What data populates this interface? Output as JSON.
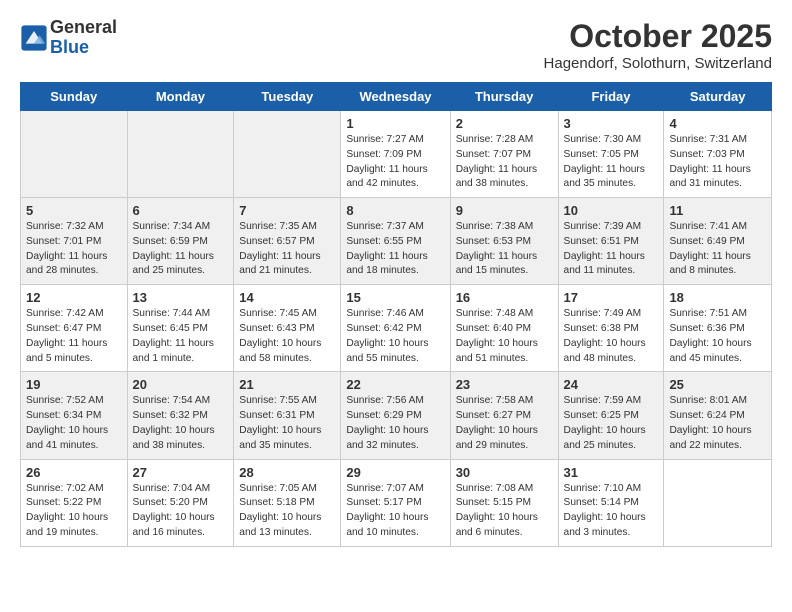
{
  "header": {
    "logo_general": "General",
    "logo_blue": "Blue",
    "month_title": "October 2025",
    "location": "Hagendorf, Solothurn, Switzerland"
  },
  "days_of_week": [
    "Sunday",
    "Monday",
    "Tuesday",
    "Wednesday",
    "Thursday",
    "Friday",
    "Saturday"
  ],
  "weeks": [
    {
      "days": [
        {
          "date": "",
          "info": ""
        },
        {
          "date": "",
          "info": ""
        },
        {
          "date": "",
          "info": ""
        },
        {
          "date": "1",
          "sunrise": "Sunrise: 7:27 AM",
          "sunset": "Sunset: 7:09 PM",
          "daylight": "Daylight: 11 hours and 42 minutes."
        },
        {
          "date": "2",
          "sunrise": "Sunrise: 7:28 AM",
          "sunset": "Sunset: 7:07 PM",
          "daylight": "Daylight: 11 hours and 38 minutes."
        },
        {
          "date": "3",
          "sunrise": "Sunrise: 7:30 AM",
          "sunset": "Sunset: 7:05 PM",
          "daylight": "Daylight: 11 hours and 35 minutes."
        },
        {
          "date": "4",
          "sunrise": "Sunrise: 7:31 AM",
          "sunset": "Sunset: 7:03 PM",
          "daylight": "Daylight: 11 hours and 31 minutes."
        }
      ]
    },
    {
      "days": [
        {
          "date": "5",
          "sunrise": "Sunrise: 7:32 AM",
          "sunset": "Sunset: 7:01 PM",
          "daylight": "Daylight: 11 hours and 28 minutes."
        },
        {
          "date": "6",
          "sunrise": "Sunrise: 7:34 AM",
          "sunset": "Sunset: 6:59 PM",
          "daylight": "Daylight: 11 hours and 25 minutes."
        },
        {
          "date": "7",
          "sunrise": "Sunrise: 7:35 AM",
          "sunset": "Sunset: 6:57 PM",
          "daylight": "Daylight: 11 hours and 21 minutes."
        },
        {
          "date": "8",
          "sunrise": "Sunrise: 7:37 AM",
          "sunset": "Sunset: 6:55 PM",
          "daylight": "Daylight: 11 hours and 18 minutes."
        },
        {
          "date": "9",
          "sunrise": "Sunrise: 7:38 AM",
          "sunset": "Sunset: 6:53 PM",
          "daylight": "Daylight: 11 hours and 15 minutes."
        },
        {
          "date": "10",
          "sunrise": "Sunrise: 7:39 AM",
          "sunset": "Sunset: 6:51 PM",
          "daylight": "Daylight: 11 hours and 11 minutes."
        },
        {
          "date": "11",
          "sunrise": "Sunrise: 7:41 AM",
          "sunset": "Sunset: 6:49 PM",
          "daylight": "Daylight: 11 hours and 8 minutes."
        }
      ]
    },
    {
      "days": [
        {
          "date": "12",
          "sunrise": "Sunrise: 7:42 AM",
          "sunset": "Sunset: 6:47 PM",
          "daylight": "Daylight: 11 hours and 5 minutes."
        },
        {
          "date": "13",
          "sunrise": "Sunrise: 7:44 AM",
          "sunset": "Sunset: 6:45 PM",
          "daylight": "Daylight: 11 hours and 1 minute."
        },
        {
          "date": "14",
          "sunrise": "Sunrise: 7:45 AM",
          "sunset": "Sunset: 6:43 PM",
          "daylight": "Daylight: 10 hours and 58 minutes."
        },
        {
          "date": "15",
          "sunrise": "Sunrise: 7:46 AM",
          "sunset": "Sunset: 6:42 PM",
          "daylight": "Daylight: 10 hours and 55 minutes."
        },
        {
          "date": "16",
          "sunrise": "Sunrise: 7:48 AM",
          "sunset": "Sunset: 6:40 PM",
          "daylight": "Daylight: 10 hours and 51 minutes."
        },
        {
          "date": "17",
          "sunrise": "Sunrise: 7:49 AM",
          "sunset": "Sunset: 6:38 PM",
          "daylight": "Daylight: 10 hours and 48 minutes."
        },
        {
          "date": "18",
          "sunrise": "Sunrise: 7:51 AM",
          "sunset": "Sunset: 6:36 PM",
          "daylight": "Daylight: 10 hours and 45 minutes."
        }
      ]
    },
    {
      "days": [
        {
          "date": "19",
          "sunrise": "Sunrise: 7:52 AM",
          "sunset": "Sunset: 6:34 PM",
          "daylight": "Daylight: 10 hours and 41 minutes."
        },
        {
          "date": "20",
          "sunrise": "Sunrise: 7:54 AM",
          "sunset": "Sunset: 6:32 PM",
          "daylight": "Daylight: 10 hours and 38 minutes."
        },
        {
          "date": "21",
          "sunrise": "Sunrise: 7:55 AM",
          "sunset": "Sunset: 6:31 PM",
          "daylight": "Daylight: 10 hours and 35 minutes."
        },
        {
          "date": "22",
          "sunrise": "Sunrise: 7:56 AM",
          "sunset": "Sunset: 6:29 PM",
          "daylight": "Daylight: 10 hours and 32 minutes."
        },
        {
          "date": "23",
          "sunrise": "Sunrise: 7:58 AM",
          "sunset": "Sunset: 6:27 PM",
          "daylight": "Daylight: 10 hours and 29 minutes."
        },
        {
          "date": "24",
          "sunrise": "Sunrise: 7:59 AM",
          "sunset": "Sunset: 6:25 PM",
          "daylight": "Daylight: 10 hours and 25 minutes."
        },
        {
          "date": "25",
          "sunrise": "Sunrise: 8:01 AM",
          "sunset": "Sunset: 6:24 PM",
          "daylight": "Daylight: 10 hours and 22 minutes."
        }
      ]
    },
    {
      "days": [
        {
          "date": "26",
          "sunrise": "Sunrise: 7:02 AM",
          "sunset": "Sunset: 5:22 PM",
          "daylight": "Daylight: 10 hours and 19 minutes."
        },
        {
          "date": "27",
          "sunrise": "Sunrise: 7:04 AM",
          "sunset": "Sunset: 5:20 PM",
          "daylight": "Daylight: 10 hours and 16 minutes."
        },
        {
          "date": "28",
          "sunrise": "Sunrise: 7:05 AM",
          "sunset": "Sunset: 5:18 PM",
          "daylight": "Daylight: 10 hours and 13 minutes."
        },
        {
          "date": "29",
          "sunrise": "Sunrise: 7:07 AM",
          "sunset": "Sunset: 5:17 PM",
          "daylight": "Daylight: 10 hours and 10 minutes."
        },
        {
          "date": "30",
          "sunrise": "Sunrise: 7:08 AM",
          "sunset": "Sunset: 5:15 PM",
          "daylight": "Daylight: 10 hours and 6 minutes."
        },
        {
          "date": "31",
          "sunrise": "Sunrise: 7:10 AM",
          "sunset": "Sunset: 5:14 PM",
          "daylight": "Daylight: 10 hours and 3 minutes."
        },
        {
          "date": "",
          "info": ""
        }
      ]
    }
  ]
}
